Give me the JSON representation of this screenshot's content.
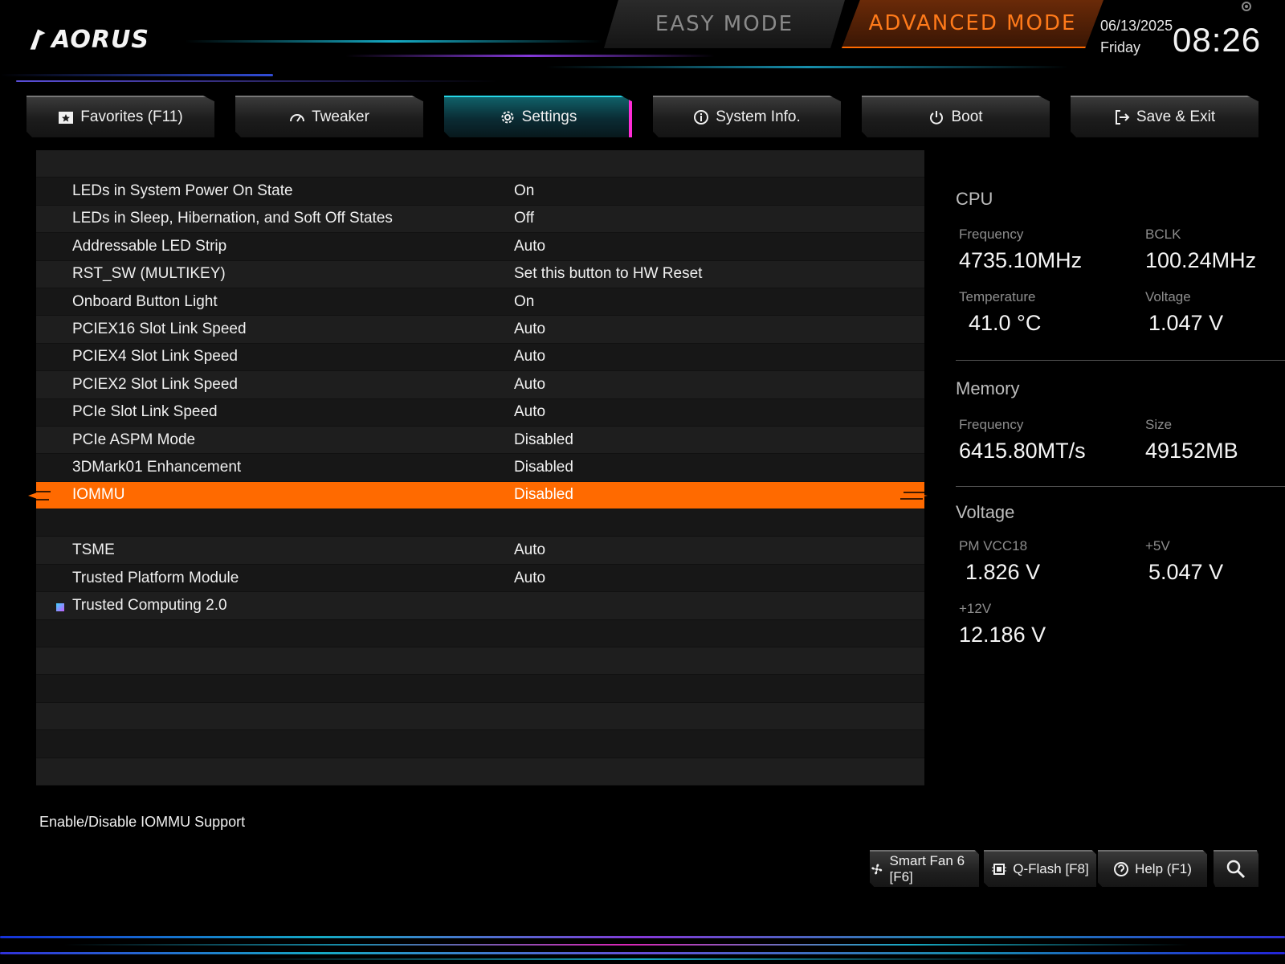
{
  "header": {
    "logo_text": "AORUS",
    "mode_easy": "EASY MODE",
    "mode_advanced": "ADVANCED MODE",
    "date": "06/13/2025",
    "day": "Friday",
    "time": "08:26",
    "accent_orange": "#ff6a00",
    "accent_cyan": "#25d7e8",
    "accent_magenta": "#ff2bd6"
  },
  "tabs": [
    {
      "label": "Favorites (F11)",
      "icon": "star-folder-icon",
      "active": false
    },
    {
      "label": "Tweaker",
      "icon": "speedometer-icon",
      "active": false
    },
    {
      "label": "Settings",
      "icon": "gear-icon",
      "active": true
    },
    {
      "label": "System Info.",
      "icon": "info-icon",
      "active": false
    },
    {
      "label": "Boot",
      "icon": "power-icon",
      "active": false
    },
    {
      "label": "Save & Exit",
      "icon": "exit-icon",
      "active": false
    }
  ],
  "settings": [
    {
      "label": "",
      "value": ""
    },
    {
      "label": "LEDs in System Power On State",
      "value": "On"
    },
    {
      "label": "LEDs in Sleep, Hibernation, and Soft Off States",
      "value": "Off"
    },
    {
      "label": "Addressable LED Strip",
      "value": "Auto"
    },
    {
      "label": "RST_SW (MULTIKEY)",
      "value": "Set this button to HW Reset"
    },
    {
      "label": "Onboard Button Light",
      "value": "On"
    },
    {
      "label": "PCIEX16 Slot Link Speed",
      "value": "Auto"
    },
    {
      "label": "PCIEX4 Slot Link Speed",
      "value": "Auto"
    },
    {
      "label": "PCIEX2 Slot Link Speed",
      "value": "Auto"
    },
    {
      "label": "PCIe Slot Link Speed",
      "value": "Auto"
    },
    {
      "label": "PCIe ASPM Mode",
      "value": "Disabled"
    },
    {
      "label": "3DMark01 Enhancement",
      "value": "Disabled"
    },
    {
      "label": "IOMMU",
      "value": "Disabled",
      "selected": true
    },
    {
      "label": "",
      "value": ""
    },
    {
      "label": "TSME",
      "value": "Auto"
    },
    {
      "label": "Trusted Platform Module",
      "value": "Auto"
    },
    {
      "label": "Trusted Computing 2.0",
      "value": "",
      "submenu": true
    },
    {
      "label": "",
      "value": ""
    },
    {
      "label": "",
      "value": ""
    },
    {
      "label": "",
      "value": ""
    },
    {
      "label": "",
      "value": ""
    },
    {
      "label": "",
      "value": ""
    },
    {
      "label": "",
      "value": ""
    }
  ],
  "monitor": {
    "cpu": {
      "title": "CPU",
      "frequency_label": "Frequency",
      "frequency": "4735.10MHz",
      "bclk_label": "BCLK",
      "bclk": "100.24MHz",
      "temperature_label": "Temperature",
      "temperature": "41.0 °C",
      "voltage_label": "Voltage",
      "voltage": "1.047 V"
    },
    "memory": {
      "title": "Memory",
      "frequency_label": "Frequency",
      "frequency": "6415.80MT/s",
      "size_label": "Size",
      "size": "49152MB"
    },
    "voltage": {
      "title": "Voltage",
      "pm_vcc18_label": "PM VCC18",
      "pm_vcc18": "1.826 V",
      "plus5v_label": "+5V",
      "plus5v": "5.047 V",
      "plus12v_label": "+12V",
      "plus12v": "12.186 V"
    }
  },
  "help_text": "Enable/Disable IOMMU Support",
  "bottom_buttons": [
    {
      "label": "Smart Fan 6 [F6]",
      "icon": "fan-icon"
    },
    {
      "label": "Q-Flash [F8]",
      "icon": "chip-icon"
    },
    {
      "label": "Help (F1)",
      "icon": "help-icon"
    },
    {
      "label": "",
      "icon": "search-icon"
    }
  ]
}
